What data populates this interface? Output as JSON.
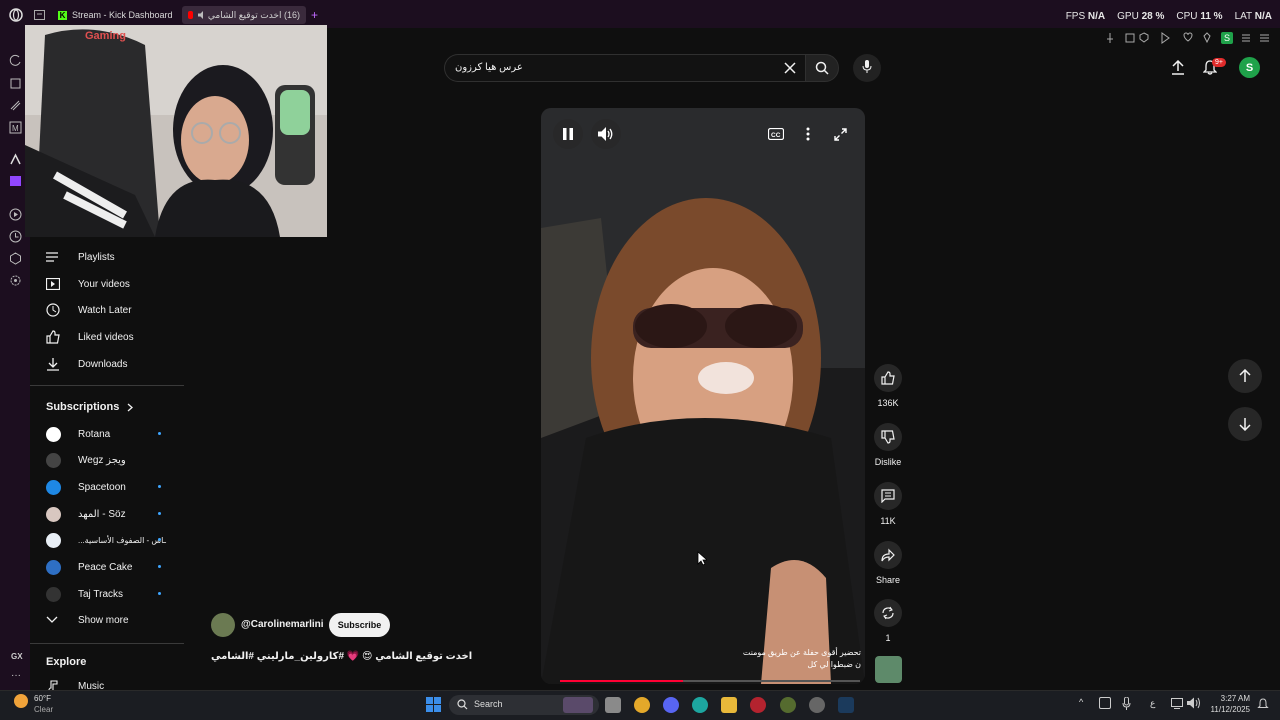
{
  "browser": {
    "tabs": [
      {
        "label": "Stream - Kick Dashboard"
      },
      {
        "label": "(16) اخدت توقيع الشامي"
      }
    ],
    "stats": {
      "fps_label": "FPS",
      "fps_value": "N/A",
      "gpu_label": "GPU",
      "gpu_value": "28 %",
      "cpu_label": "CPU",
      "cpu_value": "11 %",
      "lat_label": "LAT",
      "lat_value": "N/A"
    },
    "gx_label": "GX",
    "colors": {
      "frame": "#1c0e1f",
      "kick": "#53fc18"
    }
  },
  "youtube": {
    "search": {
      "value": "عرس هيا كرزون"
    },
    "notification_badge": "9+",
    "avatar_letter": "S",
    "sidebar": {
      "library": [
        {
          "label": "Playlists",
          "icon": "playlist-icon"
        },
        {
          "label": "Your videos",
          "icon": "your-videos-icon"
        },
        {
          "label": "Watch Later",
          "icon": "clock-icon"
        },
        {
          "label": "Liked videos",
          "icon": "thumb-up-icon"
        },
        {
          "label": "Downloads",
          "icon": "download-icon"
        }
      ],
      "subscriptions_title": "Subscriptions",
      "subscriptions": [
        {
          "label": "Rotana",
          "new": true,
          "color": "#ffffff"
        },
        {
          "label": "Wegz ويجز",
          "new": false,
          "color": "#444444"
        },
        {
          "label": "Spacetoon",
          "new": true,
          "color": "#1e88e5"
        },
        {
          "label": "المهد - Söz",
          "new": true,
          "color": "#d8c7c0"
        },
        {
          "label": "...ـاس - الصفوف الأساسية",
          "new": true,
          "color": "#e8eef5"
        },
        {
          "label": "Peace Cake",
          "new": true,
          "color": "#2e6fc4"
        },
        {
          "label": "Taj Tracks",
          "new": true,
          "color": "#333333"
        }
      ],
      "show_more": "Show more",
      "explore_title": "Explore",
      "music": "Music"
    },
    "short": {
      "channel": "@Carolinemarlini",
      "subscribe": "Subscribe",
      "title": "اخدت توقيع الشامي 😍 💗 #كارولين_مارليني #الشامي",
      "caption_line1": "تحضير أقوى حفلة عن طريق مومنت",
      "caption_line2": "ن ضبطوا لي كل",
      "progress": 0.41,
      "likes": "136K",
      "dislike": "Dislike",
      "comments": "11K",
      "share": "Share",
      "remix_count": "1"
    }
  },
  "taskbar": {
    "weather_temp": "60°F",
    "weather_desc": "Clear",
    "search": "Search",
    "time": "3:27 AM",
    "date": "11/12/2025",
    "lang": "ع"
  }
}
